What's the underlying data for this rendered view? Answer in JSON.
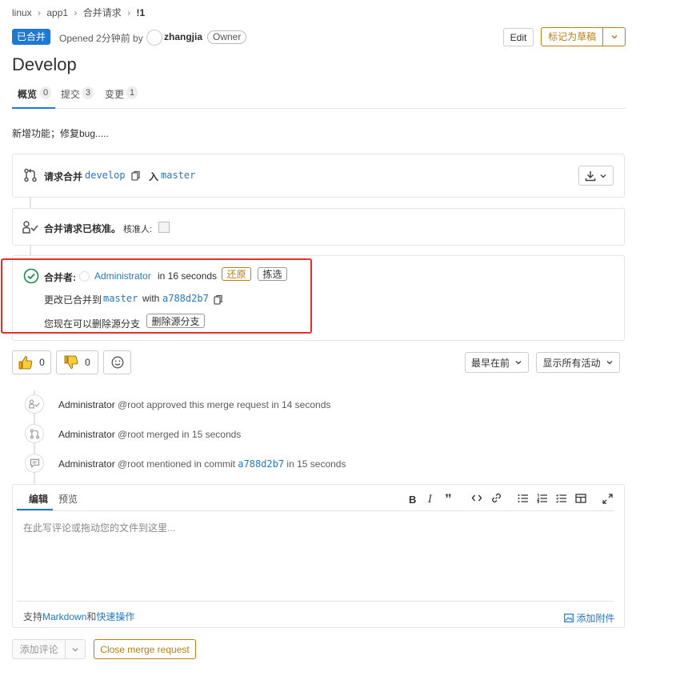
{
  "breadcrumb": {
    "items": [
      "linux",
      "app1",
      "合并请求",
      "!1"
    ]
  },
  "header": {
    "status_badge": "已合并",
    "opened_text": "Opened 2分钟前 by",
    "author": "zhangjia",
    "role_badge": "Owner",
    "edit_label": "Edit",
    "draft_label": "标记为草稿"
  },
  "title": "Develop",
  "tabs": [
    {
      "label": "概览",
      "count": "0"
    },
    {
      "label": "提交",
      "count": "3"
    },
    {
      "label": "变更",
      "count": "1"
    }
  ],
  "description": "新增功能；修复bug.....",
  "merge_request": {
    "prefix": "请求合并",
    "source_branch": "develop",
    "into": "入",
    "target_branch": "master"
  },
  "approval": {
    "text": "合并请求已核准。",
    "approvers_label": "核准人:"
  },
  "merged": {
    "label": "合并者:",
    "user": "Administrator",
    "time": "in 16 seconds",
    "revert_label": "还原",
    "cherry_pick_label": "拣选",
    "change_text": "更改已合并到",
    "branch": "master",
    "with": "with",
    "commit": "a788d2b7",
    "delete_prompt": "您现在可以删除源分支",
    "delete_label": "删除源分支"
  },
  "reactions": {
    "thumbs_up": "0",
    "thumbs_down": "0"
  },
  "sort": {
    "order_label": "最早在前",
    "filter_label": "显示所有活动"
  },
  "timeline": [
    {
      "user": "Administrator",
      "text": "@root approved this merge request in 14 seconds"
    },
    {
      "user": "Administrator",
      "text": "@root merged in 15 seconds"
    },
    {
      "user": "Administrator",
      "text_before": "@root mentioned in commit",
      "commit": "a788d2b7",
      "text_after": "in 15 seconds"
    }
  ],
  "editor": {
    "tab_write": "编辑",
    "tab_preview": "预览",
    "placeholder": "在此写评论或拖动您的文件到这里...",
    "footer_support": "支持",
    "footer_markdown": "Markdown",
    "footer_and": "和",
    "footer_quick": "快速操作",
    "attach_label": "添加附件"
  },
  "actions": {
    "comment_label": "添加评论",
    "close_label": "Close merge request"
  },
  "colors": {
    "accent": "#1f78d1",
    "draft": "#c17d10",
    "highlight": "#e8302a",
    "success": "#168f48"
  }
}
